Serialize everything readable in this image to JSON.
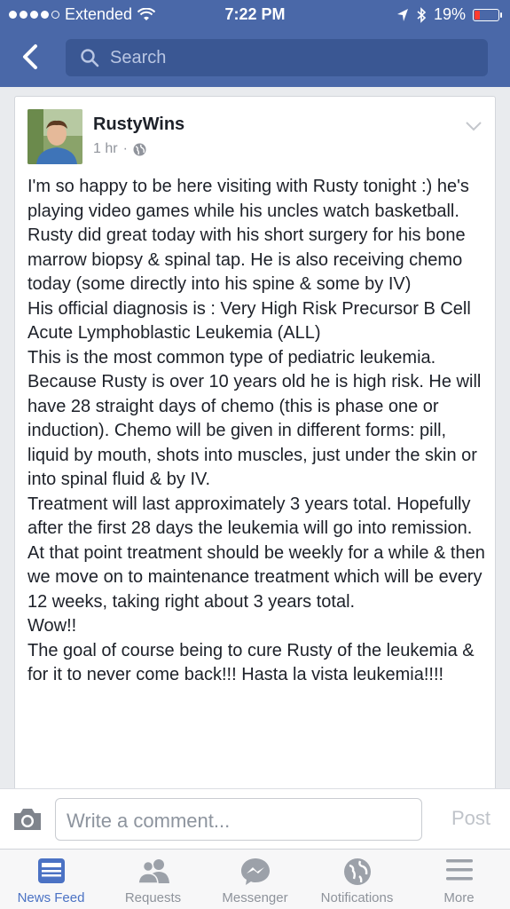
{
  "status_bar": {
    "carrier": "Extended",
    "time": "7:22 PM",
    "battery": "19%"
  },
  "search": {
    "placeholder": "Search"
  },
  "post": {
    "author": "RustyWins",
    "time": "1 hr",
    "separator": "·",
    "lines": [
      "I'm so happy to be here visiting with Rusty tonight :) he's playing video games while his uncles watch basketball.",
      "Rusty did great today with his short surgery for his bone marrow biopsy & spinal tap. He is also receiving chemo today (some directly into his spine & some by IV)",
      "His official diagnosis is : Very High Risk Precursor B Cell Acute Lymphoblastic Leukemia (ALL)",
      "This is the most common type of pediatric leukemia. Because Rusty is over 10 years old he is high risk. He will have 28 straight days of chemo (this is phase one or induction). Chemo will be given in different forms: pill, liquid by mouth, shots into muscles, just under the skin or into spinal fluid & by IV.",
      "Treatment will last approximately 3 years total. Hopefully after the first 28 days the leukemia will go into remission. At that point treatment should be weekly for a while & then we move on to maintenance treatment which will be every 12 weeks, taking right about 3 years total.",
      "Wow!!",
      "The goal of course being to cure Rusty of the leukemia & for it to never come back!!! Hasta la vista leukemia!!!!"
    ]
  },
  "comment": {
    "placeholder": "Write a comment...",
    "post_label": "Post"
  },
  "tabs": [
    {
      "label": "News Feed",
      "icon": "news-feed-icon",
      "active": true
    },
    {
      "label": "Requests",
      "icon": "requests-icon",
      "active": false
    },
    {
      "label": "Messenger",
      "icon": "messenger-icon",
      "active": false
    },
    {
      "label": "Notifications",
      "icon": "notifications-icon",
      "active": false
    },
    {
      "label": "More",
      "icon": "more-icon",
      "active": false
    }
  ],
  "colors": {
    "header_blue": "#4a68a8",
    "active_tab": "#4b72c4",
    "battery_low": "#ff3b30"
  }
}
